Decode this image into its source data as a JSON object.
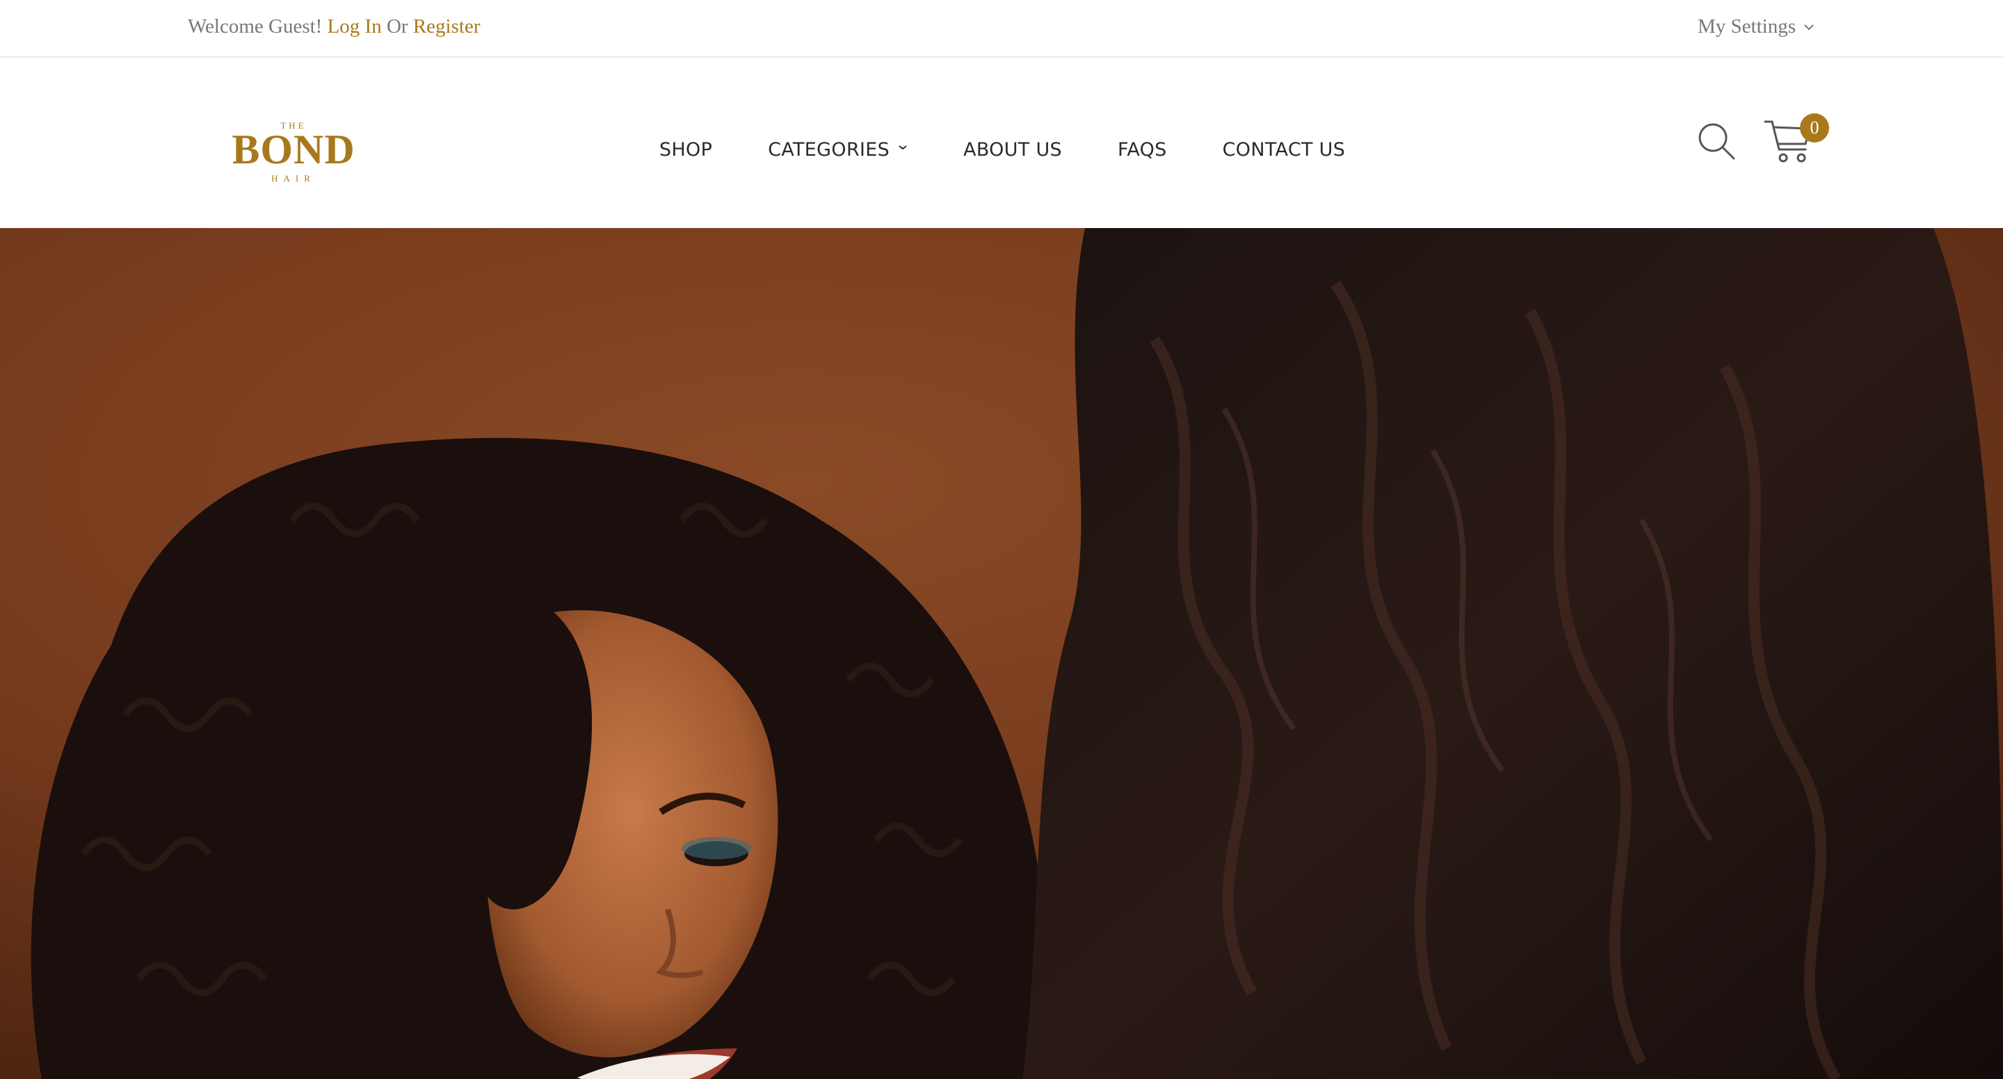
{
  "topbar": {
    "welcome_text": "Welcome Guest!",
    "login_label": "Log In",
    "or_text": "Or",
    "register_label": "Register",
    "settings_label": "My Settings"
  },
  "brand": {
    "logo_top": "THE",
    "logo_main": "BOND",
    "logo_bottom": "HAIR",
    "accent_color": "#a8791c"
  },
  "nav": {
    "items": [
      {
        "label": "SHOP"
      },
      {
        "label": "CATEGORIES",
        "has_dropdown": true
      },
      {
        "label": "ABOUT US"
      },
      {
        "label": "FAQS"
      },
      {
        "label": "CONTACT US"
      }
    ]
  },
  "header_icons": {
    "search_icon": "search-icon",
    "cart_icon": "cart-icon",
    "cart_count": "0"
  },
  "hero": {
    "background_color": "#7a3d1f",
    "image": "hero-banner-image"
  }
}
